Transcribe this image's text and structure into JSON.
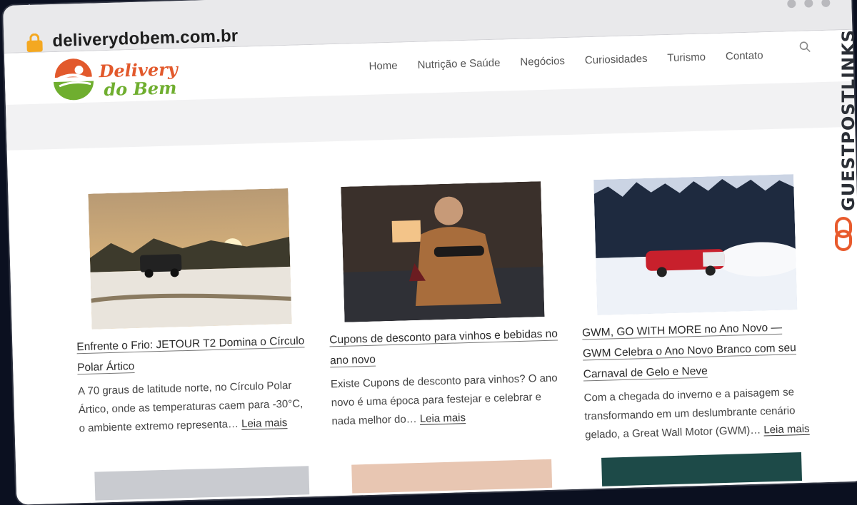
{
  "browser": {
    "url": "deliverydobem.com.br"
  },
  "site": {
    "logo_line1": "Delivery",
    "logo_line2": "do Bem",
    "nav": [
      "Home",
      "Nutrição e Saúde",
      "Negócios",
      "Curiosidades",
      "Turismo",
      "Contato"
    ]
  },
  "posts": [
    {
      "title": "Enfrente o Frio: JETOUR T2 Domina o Círculo Polar Ártico",
      "excerpt": "A 70 graus de latitude norte, no Círculo Polar Ártico, onde as temperaturas caem para -30°C, o ambiente extremo representa…",
      "more": "Leia mais"
    },
    {
      "title": "Cupons de desconto para vinhos e bebidas no ano novo",
      "excerpt": "Existe Cupons de desconto para vinhos? O ano novo é uma época para festejar e celebrar e nada melhor do…",
      "more": "Leia mais"
    },
    {
      "title": "GWM, GO WITH MORE no Ano Novo — GWM Celebra o Ano Novo Branco com seu Carnaval de Gelo e Neve",
      "excerpt": "Com a chegada do inverno e a paisagem se transformando em um deslumbrante cenário gelado, a Great Wall Motor (GWM)…",
      "more": "Leia mais"
    }
  ],
  "badge": {
    "text": "GUESTPOSTLINKS"
  },
  "colors": {
    "accent_orange": "#e2592c",
    "accent_green": "#6fae2f",
    "lock": "#f4a821"
  }
}
